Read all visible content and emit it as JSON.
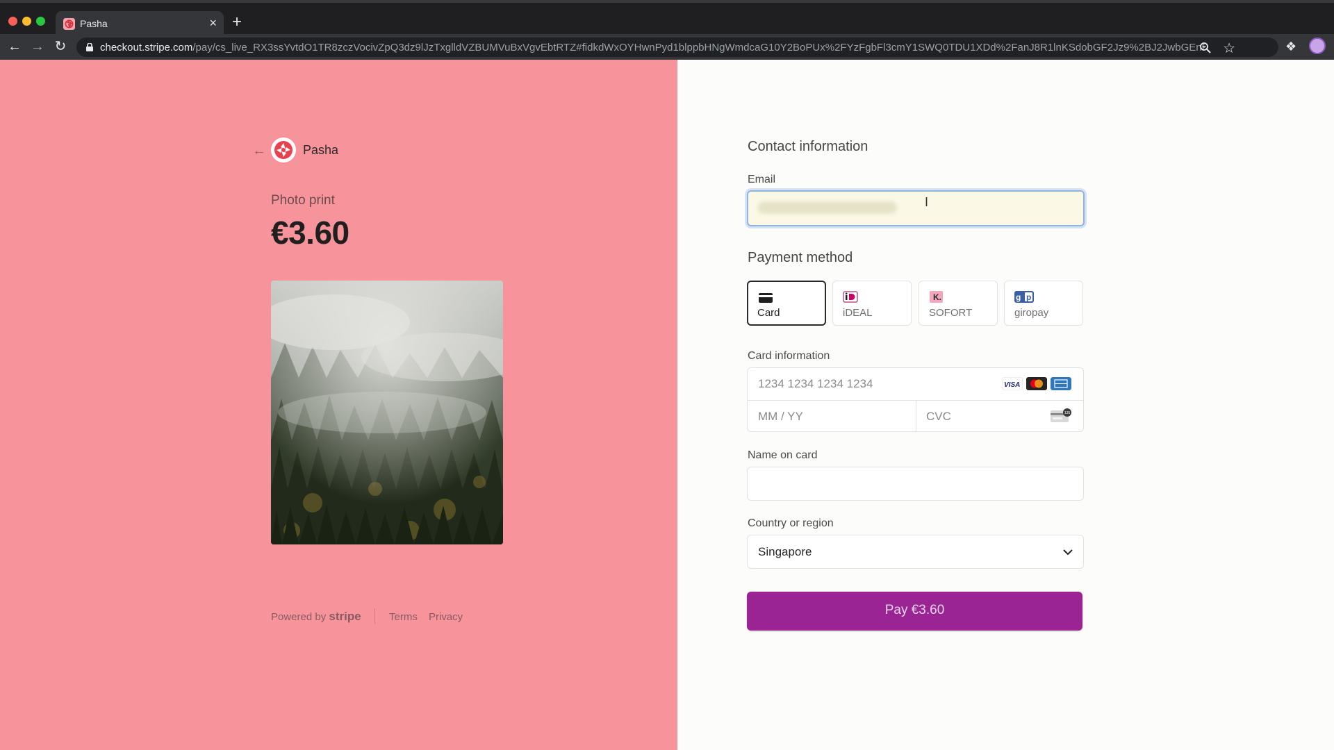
{
  "browser": {
    "tab_title": "Pasha",
    "tab_close": "×",
    "new_tab": "+",
    "url_host": "checkout.stripe.com",
    "url_path": "/pay/cs_live_RX3ssYvtdO1TR8zczVocivZpQ3dz9lJzTxglldVZBUMVuBxVgvEbtRTZ#fidkdWxOYHwnPyd1blppbHNgWmdcaG10Y2BoPUx%2FYzFgbFl3cmY1SWQ0TDU1XDd%2FanJ8R1lnKSdobGF2Jz9%2BJ2JwbGEnPyc9PD..."
  },
  "merchant": {
    "name": "Pasha"
  },
  "product": {
    "name": "Photo print",
    "price": "€3.60"
  },
  "footer": {
    "powered_by": "Powered by",
    "stripe": "stripe",
    "terms": "Terms",
    "privacy": "Privacy"
  },
  "contact": {
    "title": "Contact information",
    "email_label": "Email"
  },
  "payment": {
    "title": "Payment method",
    "methods": [
      {
        "label": "Card",
        "selected": true,
        "icon": "card-icon",
        "color": "#1f1f1f"
      },
      {
        "label": "iDEAL",
        "selected": false,
        "icon": "ideal-icon",
        "color": "#cc0066"
      },
      {
        "label": "SOFORT",
        "selected": false,
        "icon": "sofort-icon",
        "color": "#ef809f"
      },
      {
        "label": "giropay",
        "selected": false,
        "icon": "giropay-icon",
        "color": "#3b5fa6"
      }
    ]
  },
  "card": {
    "label": "Card information",
    "number_placeholder": "1234 1234 1234 1234",
    "expiry_placeholder": "MM / YY",
    "cvc_placeholder": "CVC",
    "brands": [
      "visa",
      "mastercard",
      "amex"
    ]
  },
  "name_on_card": {
    "label": "Name on card"
  },
  "country": {
    "label": "Country or region",
    "value": "Singapore"
  },
  "pay_button": {
    "label": "Pay €3.60"
  },
  "colors": {
    "left_panel": "#f7939b",
    "pay_button": "#9b2495"
  }
}
